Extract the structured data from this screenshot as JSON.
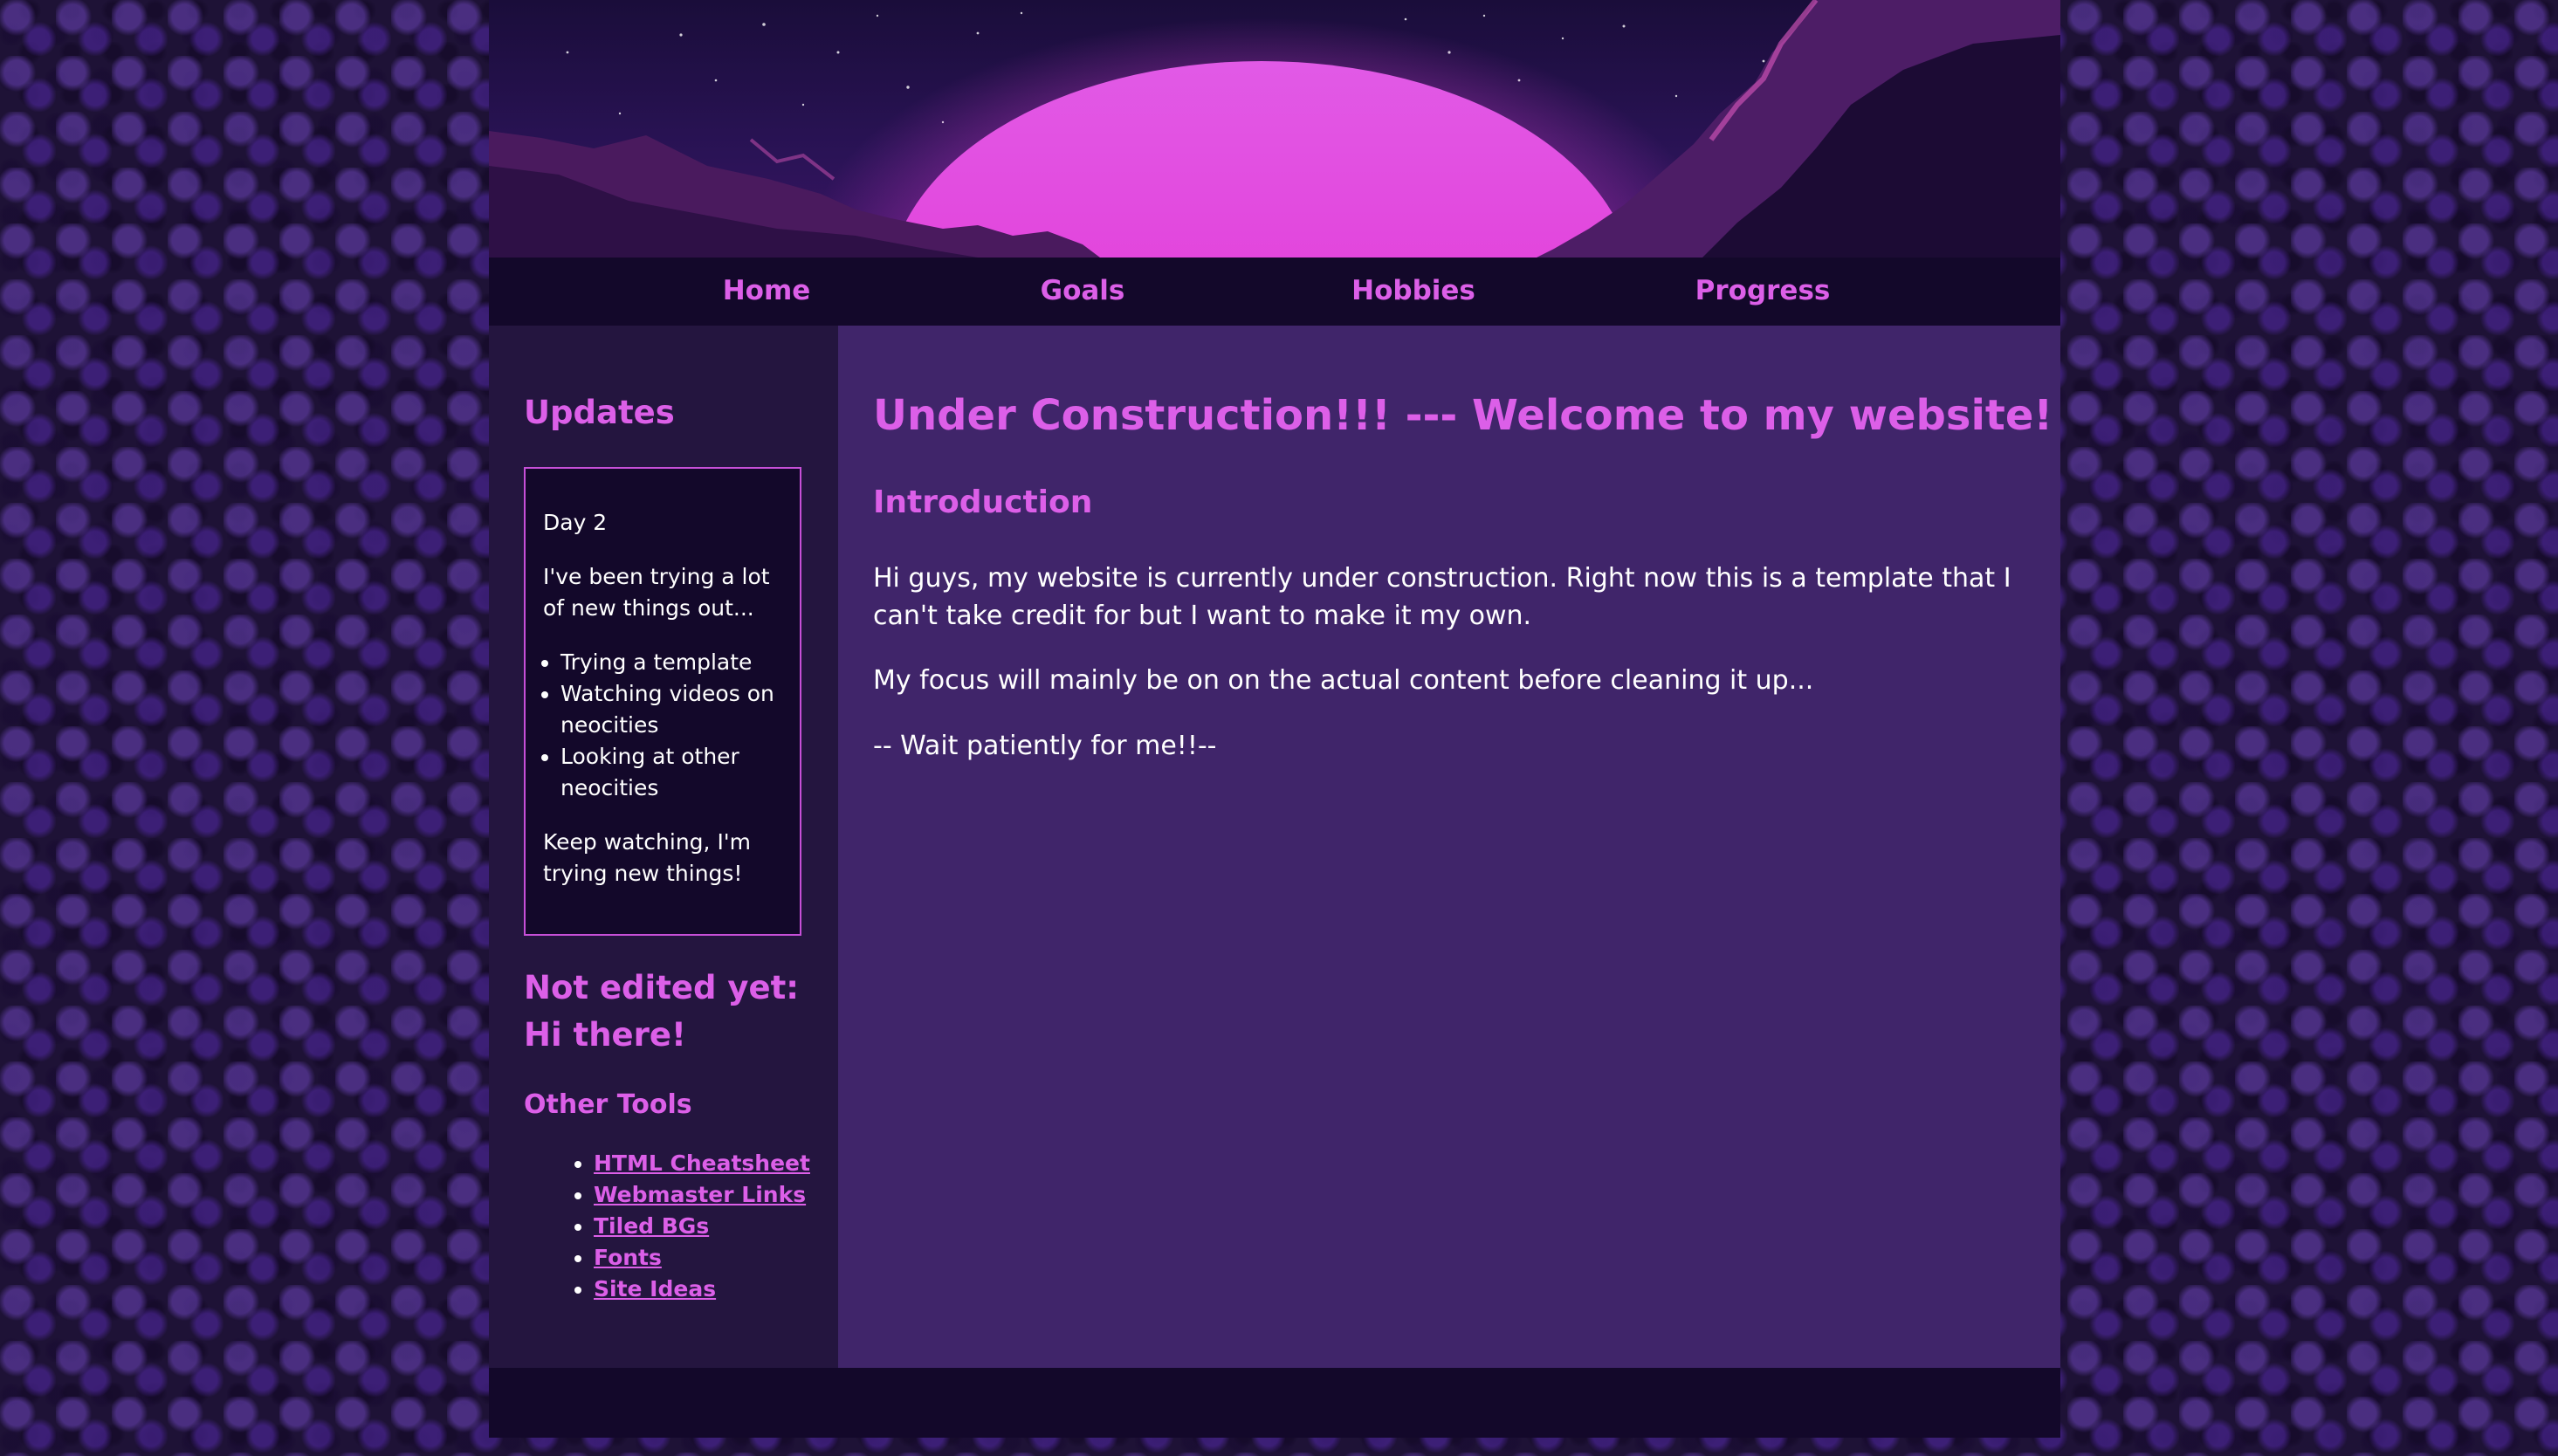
{
  "nav": {
    "items": [
      {
        "label": "Home"
      },
      {
        "label": "Goals"
      },
      {
        "label": "Hobbies"
      },
      {
        "label": "Progress"
      }
    ]
  },
  "sidebar": {
    "updates_heading": "Updates",
    "update_box": {
      "day": "Day 2",
      "intro": "I've been trying a lot of new things out...",
      "items": [
        "Trying a template",
        "Watching videos on neocities",
        "Looking at other neocities"
      ],
      "outro": "Keep watching, I'm trying new things!"
    },
    "not_edited_heading": "Not edited yet:",
    "hi_heading": "Hi there!",
    "tools_heading": "Other Tools",
    "tools": [
      {
        "label": "HTML Cheatsheet"
      },
      {
        "label": "Webmaster Links"
      },
      {
        "label": "Tiled BGs"
      },
      {
        "label": "Fonts"
      },
      {
        "label": "Site Ideas"
      }
    ]
  },
  "main": {
    "title": "Under Construction!!! --- Welcome to my website!",
    "subtitle": "Introduction",
    "paragraphs": [
      "Hi guys, my website is currently under construction. Right now this is a template that I can't take credit for but I want to make it my own.",
      "My focus will mainly be on on the actual content before cleaning it up...",
      "-- Wait patiently for me!!--"
    ]
  },
  "colors": {
    "accent": "#dc5fe8",
    "page_background": "#1e1236",
    "container": "#13082a",
    "sidebar": "#24153f",
    "main": "#40256a",
    "text": "#ffffff"
  }
}
